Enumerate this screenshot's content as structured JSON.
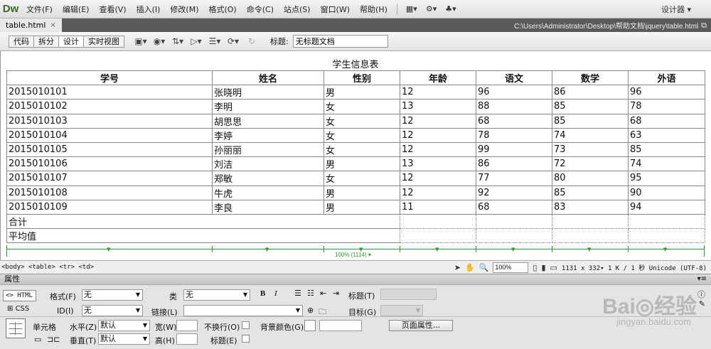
{
  "app": {
    "logo": "Dw",
    "workspace": "设计器 ▾"
  },
  "menu": [
    "文件(F)",
    "编辑(E)",
    "查看(V)",
    "插入(I)",
    "修改(M)",
    "格式(O)",
    "命令(C)",
    "站点(S)",
    "窗口(W)",
    "帮助(H)"
  ],
  "menu_icons": [
    "▦▾",
    "⚙▾",
    "♣▾"
  ],
  "document": {
    "tab": "table.html",
    "close": "×",
    "path": "C:\\Users\\Administrator\\Desktop\\帮助文档\\jquery\\table.html",
    "restore": "⧉"
  },
  "toolbar": {
    "views": [
      "代码",
      "拆分",
      "设计",
      "实时视图"
    ],
    "active_view": "设计",
    "icons": [
      "▣▾",
      "◉▾",
      "⇅▾",
      "▷▾",
      "☰▾",
      "⟳▾",
      "↻"
    ],
    "title_label": "标题:",
    "title_value": "无标题文档"
  },
  "table": {
    "caption": "学生信息表",
    "headers": [
      "学号",
      "姓名",
      "性别",
      "年龄",
      "语文",
      "数学",
      "外语"
    ],
    "rows": [
      [
        "2015010101",
        "张晓明",
        "男",
        "12",
        "96",
        "86",
        "96"
      ],
      [
        "2015010102",
        "李明",
        "女",
        "13",
        "88",
        "85",
        "78"
      ],
      [
        "2015010103",
        "胡思思",
        "女",
        "12",
        "68",
        "85",
        "68"
      ],
      [
        "2015010104",
        "李婷",
        "女",
        "12",
        "78",
        "74",
        "63"
      ],
      [
        "2015010105",
        "孙丽丽",
        "女",
        "12",
        "99",
        "73",
        "85"
      ],
      [
        "2015010106",
        "刘洁",
        "男",
        "13",
        "86",
        "72",
        "74"
      ],
      [
        "2015010107",
        "郑敏",
        "女",
        "12",
        "77",
        "80",
        "95"
      ],
      [
        "2015010108",
        "牛虎",
        "男",
        "12",
        "92",
        "85",
        "90"
      ],
      [
        "2015010109",
        "李良",
        "男",
        "11",
        "68",
        "83",
        "94"
      ]
    ],
    "footer": [
      "合计",
      "平均值"
    ],
    "width_label": "100% (1114) ▾"
  },
  "status": {
    "tags": "<body> <table> <tr> <td>",
    "zoom": "100%",
    "dims": "1131 x 332▾ 1 K / 1 秒 Unicode (UTF-8)"
  },
  "properties": {
    "panel_title": "属性",
    "html_btn": "<> HTML",
    "css_btn": "CSS",
    "format_label": "格式(F)",
    "format_value": "无",
    "class_label": "类",
    "class_value": "无",
    "id_label": "ID(I)",
    "id_value": "无",
    "link_label": "链接(L)",
    "title_label": "标题(T)",
    "target_label": "目标(G)",
    "bold": "B",
    "italic": "I",
    "cell_label": "单元格",
    "horz_label": "水平(Z)",
    "horz_value": "默认",
    "vert_label": "垂直(T)",
    "vert_value": "默认",
    "width_label": "宽(W)",
    "height_label": "高(H)",
    "nowrap_label": "不换行(O)",
    "header_label": "标题(E)",
    "bg_label": "背景颜色(G)",
    "page_props": "页面属性..."
  },
  "watermark": {
    "brand": "Bai◎经验",
    "url": "jingyan.baidu.com"
  }
}
